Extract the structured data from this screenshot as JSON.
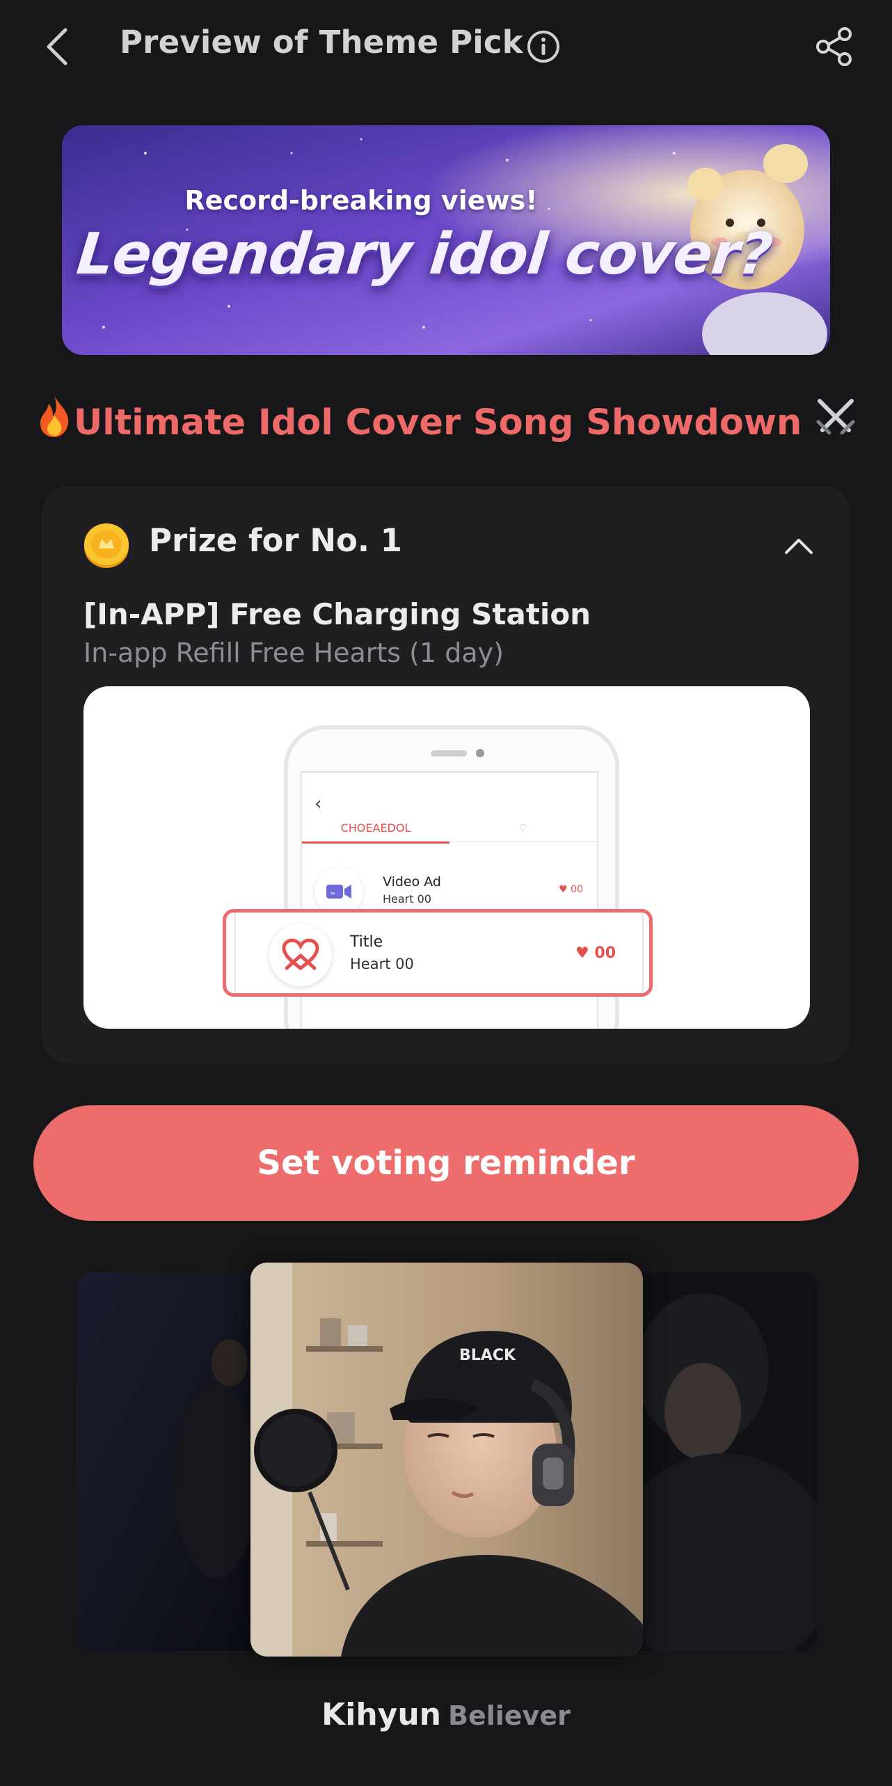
{
  "header": {
    "title": "Preview of Theme Pick",
    "back_icon": "chevron-left-icon",
    "info_icon": "info-icon",
    "share_icon": "share-icon"
  },
  "banner": {
    "subtitle": "Record-breaking views!",
    "headline": "Legendary idol cover?"
  },
  "event": {
    "prefix_emoji": "🔥",
    "title": "Ultimate Idol Cover Song Showdown",
    "suffix_emoji": "⚔️"
  },
  "prize": {
    "heading": "Prize for No. 1",
    "name": "[In-APP] Free Charging Station",
    "description": "In-app Refill Free Hearts (1 day)",
    "mockup": {
      "tab_label": "CHOEAEDOL",
      "row1_title": "Video Ad",
      "row1_sub": "Heart 00",
      "row1_count": "♥ 00",
      "row2_title": "Title",
      "row2_sub": "Heart 00",
      "row2_count": "♥ 00"
    }
  },
  "cta": {
    "label": "Set voting reminder"
  },
  "video": {
    "artist": "Kihyun",
    "song": "Believer"
  },
  "colors": {
    "background": "#17171a",
    "card": "#1f1f22",
    "accent": "#ec6d6b"
  }
}
